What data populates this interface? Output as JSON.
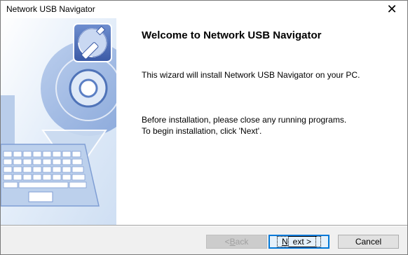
{
  "window": {
    "title": "Network USB Navigator"
  },
  "main": {
    "heading": "Welcome to Network USB Navigator",
    "intro": "This wizard will install Network USB Navigator on your PC.",
    "instructions_line1": "Before installation, please close any running programs.",
    "instructions_line2": "To begin installation, click 'Next'."
  },
  "buttons": {
    "back_prefix": "< ",
    "back_mnemonic": "B",
    "back_rest": "ack",
    "next_mnemonic": "N",
    "next_rest": "ext >",
    "cancel": "Cancel"
  },
  "icons": {
    "close": "close-icon",
    "app": "usb-navigator-logo",
    "illustration": "laptop-disc-illustration"
  },
  "colors": {
    "accent": "#0078d7",
    "illustration_blue": "#5b7fc4"
  }
}
